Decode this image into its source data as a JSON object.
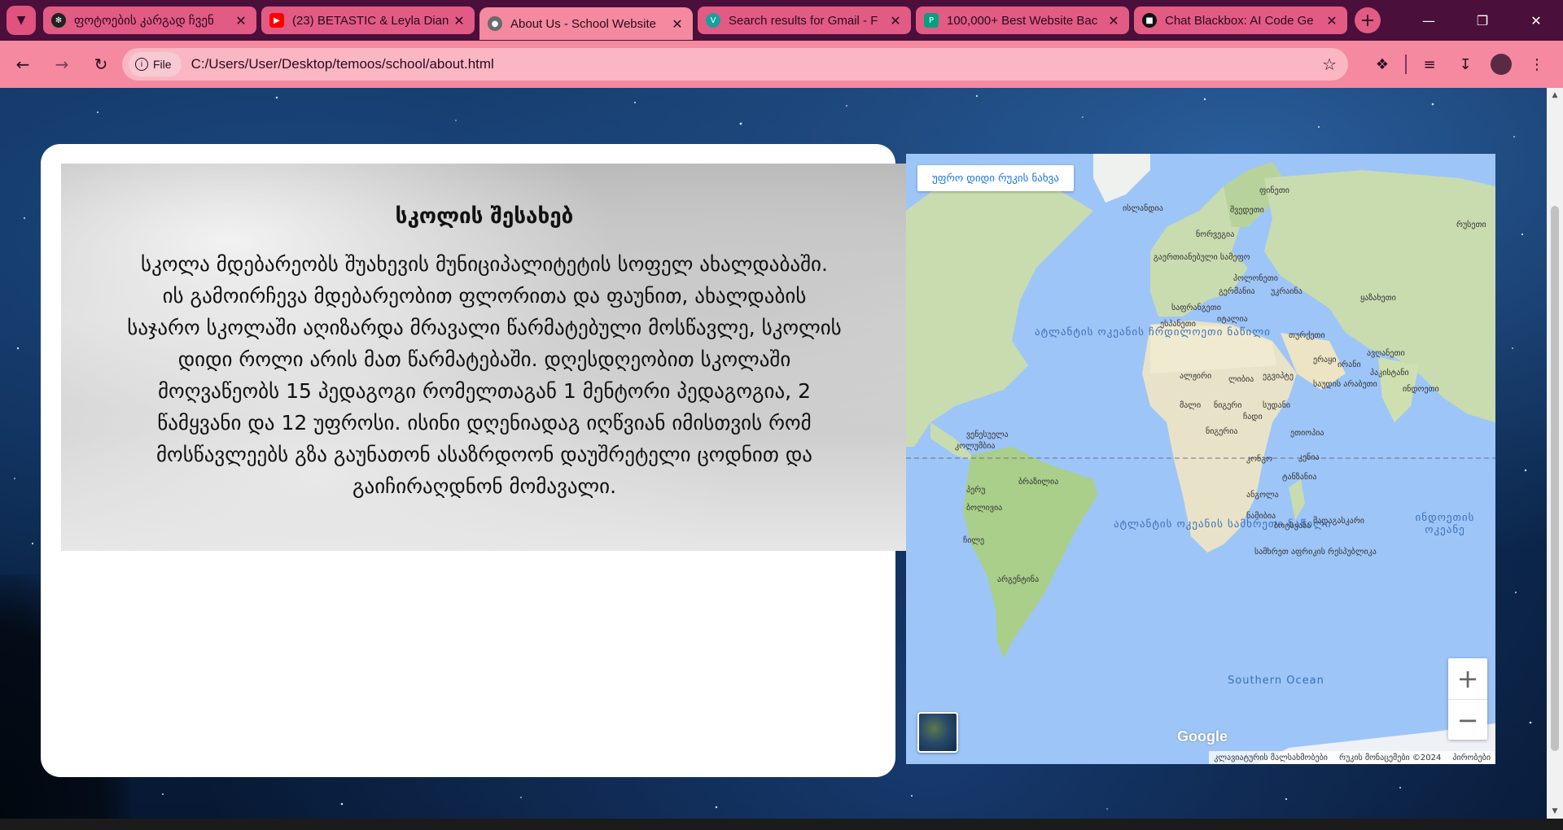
{
  "browser": {
    "tabs": [
      {
        "title": "ფოტოების კარგად ჩვენ",
        "favicon": "chatgpt-icon",
        "color": "#202123"
      },
      {
        "title": "(23) BETASTIC & Leyla Dian",
        "favicon": "youtube-icon",
        "color": "#ff0000"
      },
      {
        "title": "About Us - School Website",
        "favicon": "globe-icon",
        "color": "#5a5a5a",
        "active": true
      },
      {
        "title": "Search results for Gmail - F",
        "favicon": "vector-icon",
        "color": "#18a0a0"
      },
      {
        "title": "100,000+ Best Website Bac",
        "favicon": "pexels-icon",
        "color": "#05a081"
      },
      {
        "title": "Chat Blackbox: AI Code Ge",
        "favicon": "blackbox-icon",
        "color": "#111111"
      }
    ],
    "omnibox": {
      "chip_label": "File",
      "url": "C:/Users/User/Desktop/temoos/school/about.html"
    }
  },
  "about": {
    "heading": "სკოლის შესახებ",
    "paragraph_lines": [
      "სკოლა მდებარეობს შუახევის მუნიციპალიტეტის სოფელ ახალდაბაში.",
      "ის გამოირჩევა მდებარეობით ფლორითა და ფაუნით, ახალდაბის",
      "საჯარო სკოლაში აღიზარდა მრავალი წარმატებული მოსწავლე, სკოლის",
      "დიდი როლი არის მათ წარმატებაში. დღესდღეობით სკოლაში",
      "მოღვაწეობს 15 პედაგოგი რომელთაგან 1 მენტორი პედაგოგია, 2",
      "წამყვანი და 12 უფროსი. ისინი დღენიადაგ იღწვიან იმისთვის რომ",
      "მოსწავლეებს გზა გაუნათონ ასაზრდოონ დაუშრეტელი ცოდნით და",
      "გაიჩირაღდნონ მომავალი."
    ]
  },
  "map": {
    "view_larger_label": "უფრო დიდი რუკის ნახვა",
    "zoom_in": "+",
    "zoom_out": "−",
    "logo": "Google",
    "attribution": [
      "კლავიატურის მალსახმობები",
      "რუკის მონაცემები ©2024",
      "პირობები"
    ],
    "oceans": [
      {
        "name": "ატლანტის ოკეანის ჩრდილოეთი ნაწილი"
      },
      {
        "name": "ატლანტის ოკეანის სამხრეთი ნაწილი"
      },
      {
        "name": "ინდოეთის ოკეანე"
      },
      {
        "name": "Southern Ocean"
      }
    ],
    "places": [
      {
        "name": "ფინეთი"
      },
      {
        "name": "რუსეთი"
      },
      {
        "name": "ისლანდია"
      },
      {
        "name": "შვედეთი"
      },
      {
        "name": "ნორვეგია"
      },
      {
        "name": "გაერთიანებული სამეფო"
      },
      {
        "name": "პოლონეთი"
      },
      {
        "name": "გერმანია"
      },
      {
        "name": "უკრაინა"
      },
      {
        "name": "ყაზახეთი"
      },
      {
        "name": "საფრანგეთი"
      },
      {
        "name": "იტალია"
      },
      {
        "name": "ესპანეთი"
      },
      {
        "name": "თურქეთი"
      },
      {
        "name": "ერაყი"
      },
      {
        "name": "ირანი"
      },
      {
        "name": "ავღანეთი"
      },
      {
        "name": "პაკისტანი"
      },
      {
        "name": "ინდოეთი"
      },
      {
        "name": "ალჟირი"
      },
      {
        "name": "ლიბია"
      },
      {
        "name": "ეგვიპტე"
      },
      {
        "name": "საუდის არაბეთი"
      },
      {
        "name": "მალი"
      },
      {
        "name": "ნიგერი"
      },
      {
        "name": "სუდანი"
      },
      {
        "name": "ჩადი"
      },
      {
        "name": "ნიგერია"
      },
      {
        "name": "ეთიოპია"
      },
      {
        "name": "კენია"
      },
      {
        "name": "კონგო"
      },
      {
        "name": "ტანზანია"
      },
      {
        "name": "ანგოლა"
      },
      {
        "name": "ნამიბია"
      },
      {
        "name": "ბოტსვანა"
      },
      {
        "name": "მადაგასკარი"
      },
      {
        "name": "სამხრეთ აფრიკის რესპუბლიკა"
      },
      {
        "name": "ვენესუელა"
      },
      {
        "name": "კოლუმბია"
      },
      {
        "name": "ბრაზილია"
      },
      {
        "name": "პერუ"
      },
      {
        "name": "ბოლივია"
      },
      {
        "name": "ჩილე"
      },
      {
        "name": "არგენტინა"
      }
    ]
  }
}
